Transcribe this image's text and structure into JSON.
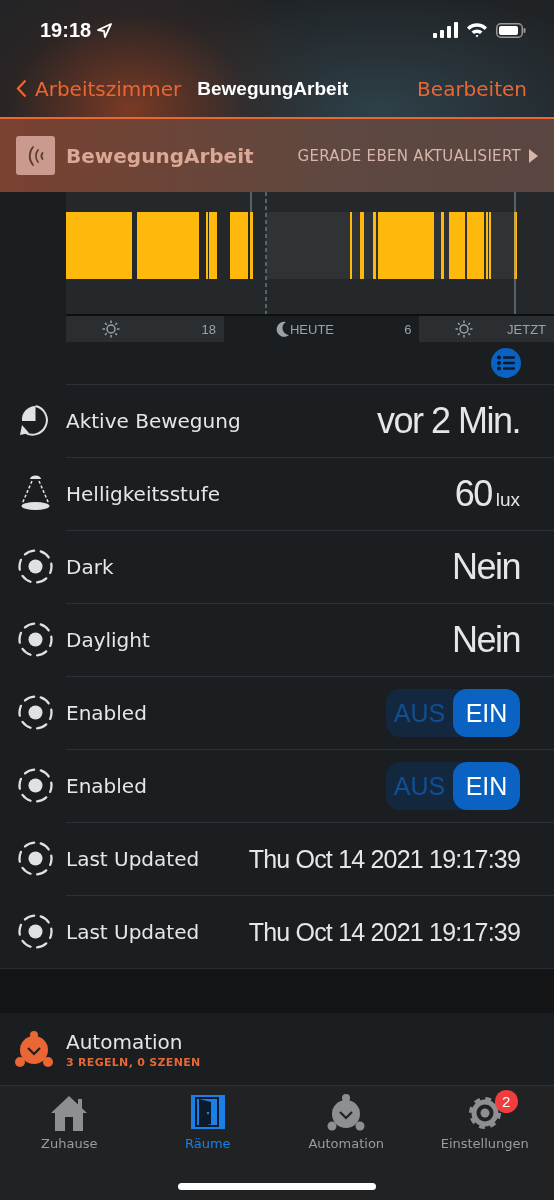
{
  "status_bar": {
    "time": "19:18"
  },
  "nav": {
    "back": "Arbeitszimmer",
    "title": "BewegungArbeit",
    "action": "Bearbeiten"
  },
  "device": {
    "name": "BewegungArbeit",
    "updated": "GERADE EBEN AKTUALISIERT"
  },
  "timeline": {
    "axis": [
      {
        "kind": "day",
        "label": "18"
      },
      {
        "kind": "night",
        "label": "HEUTE",
        "end": "6"
      },
      {
        "kind": "day",
        "label": "JETZT"
      }
    ]
  },
  "rows": [
    {
      "kind": "motion",
      "label": "Aktive Bewegung",
      "value": "vor 2 Min."
    },
    {
      "kind": "brightness",
      "label": "Helligkeitsstufe",
      "value": "60",
      "unit": "lux"
    },
    {
      "kind": "text",
      "label": "Dark",
      "value": "Nein"
    },
    {
      "kind": "text",
      "label": "Daylight",
      "value": "Nein"
    },
    {
      "kind": "toggle",
      "label": "Enabled",
      "off_label": "AUS",
      "on_label": "EIN",
      "on": true
    },
    {
      "kind": "toggle",
      "label": "Enabled",
      "off_label": "AUS",
      "on_label": "EIN",
      "on": true
    },
    {
      "kind": "date",
      "label": "Last Updated",
      "value": "Thu Oct 14 2021 19:17:39"
    },
    {
      "kind": "date",
      "label": "Last Updated",
      "value": "Thu Oct 14 2021 19:17:39"
    }
  ],
  "automation": {
    "title": "Automation",
    "subtitle": "3 REGELN, 0 SZENEN"
  },
  "tabs": [
    {
      "kind": "home",
      "label": "Zuhause",
      "selected": false
    },
    {
      "kind": "rooms",
      "label": "Räume",
      "selected": true
    },
    {
      "kind": "automation",
      "label": "Automation",
      "selected": false
    },
    {
      "kind": "settings",
      "label": "Einstellungen",
      "selected": false,
      "badge": "2"
    }
  ]
}
